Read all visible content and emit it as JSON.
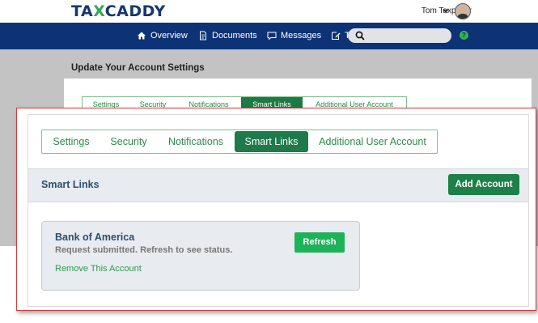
{
  "header": {
    "logo_part1": "TA",
    "logo_x": "X",
    "logo_part2": "CADDY",
    "user_name": "Tom Taxpayer",
    "caret_icon": "chevron-down-icon",
    "brand_color": "#0d3275",
    "accent_color": "#35a853"
  },
  "nav": {
    "items": [
      {
        "label": "Overview",
        "icon": "home-icon"
      },
      {
        "label": "Documents",
        "icon": "document-icon"
      },
      {
        "label": "Messages",
        "icon": "message-icon"
      },
      {
        "label": "T",
        "icon": "edit-icon"
      }
    ],
    "search_placeholder": "",
    "help_label": "?"
  },
  "background": {
    "title": "Update Your Account Settings",
    "tabs": [
      "Settings",
      "Security",
      "Notifications",
      "Smart Links",
      "Additional User Account"
    ],
    "active_tab": "Smart Links"
  },
  "panel": {
    "tabs": [
      "Settings",
      "Security",
      "Notifications",
      "Smart Links",
      "Additional User Account"
    ],
    "active_tab": "Smart Links",
    "section_title": "Smart Links",
    "add_button": "Add Account",
    "account": {
      "name": "Bank of America",
      "status": "Request submitted. Refresh to see status.",
      "refresh_button": "Refresh",
      "remove_link": "Remove This Account"
    }
  }
}
